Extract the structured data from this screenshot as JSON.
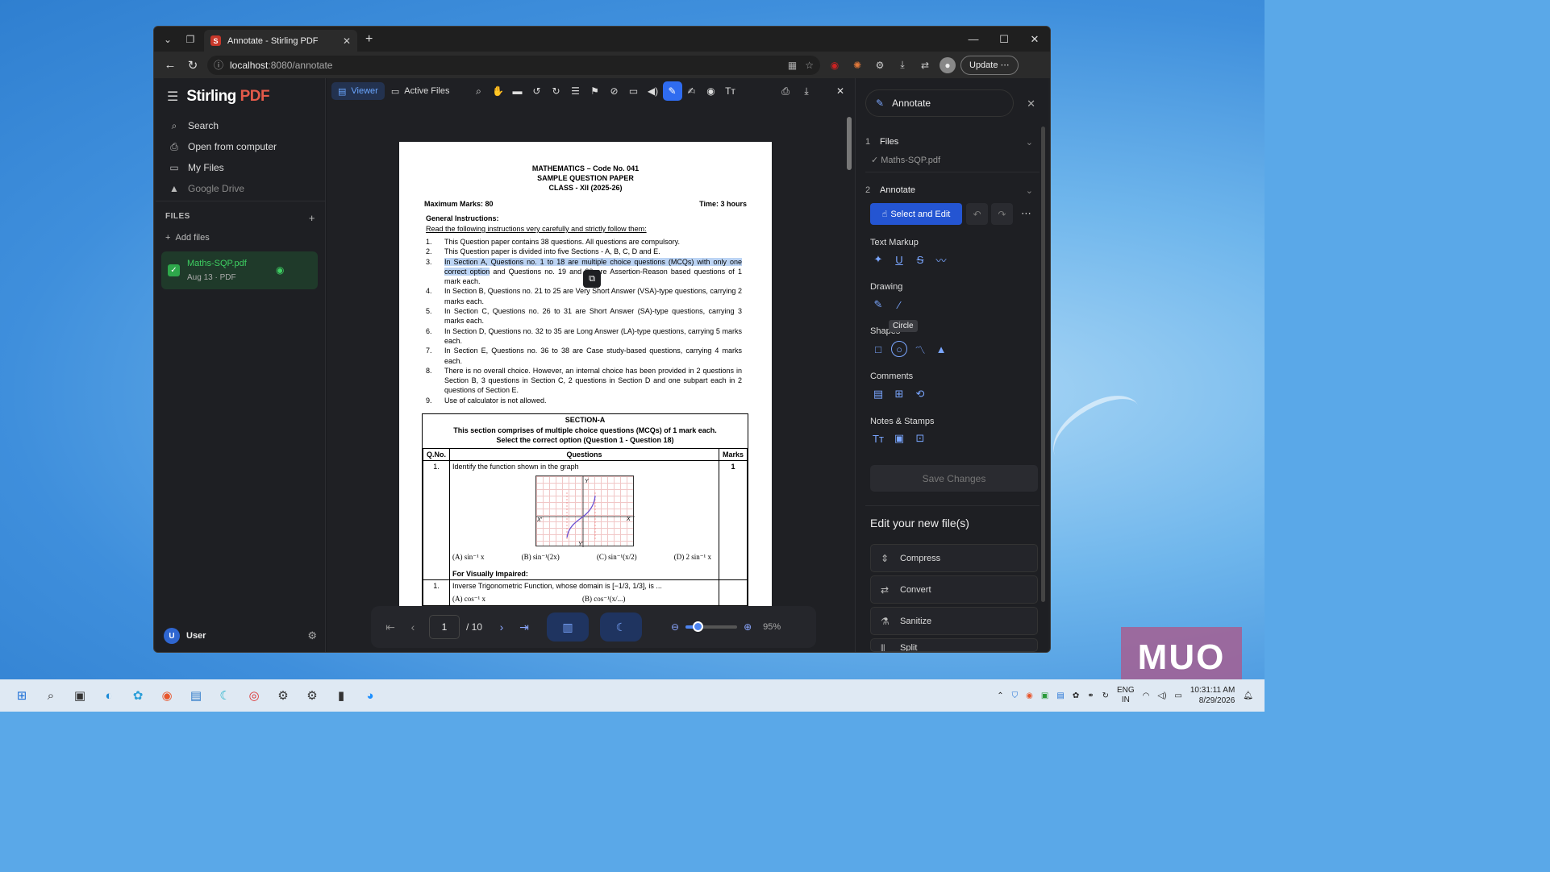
{
  "browser": {
    "tab_title": "Annotate - Stirling PDF",
    "url_host": "localhost",
    "url_path": ":8080/annotate",
    "update_label": "Update"
  },
  "app": {
    "brand_name": "Stirling",
    "brand_suffix": "PDF",
    "menu": [
      {
        "label": "Search",
        "icon": "search-icon"
      },
      {
        "label": "Open from computer",
        "icon": "file-upload-icon"
      },
      {
        "label": "My Files",
        "icon": "folder-icon"
      },
      {
        "label": "Google Drive",
        "icon": "google-drive-icon"
      }
    ],
    "files_header": "FILES",
    "add_files": "Add files",
    "file": {
      "name": "Maths-SQP.pdf",
      "meta": "Aug 13 · PDF"
    },
    "user_name": "User",
    "user_initial": "U"
  },
  "viewer": {
    "tabs": [
      "Viewer",
      "Active Files"
    ],
    "active_tool": "draw-icon",
    "page_number": "1",
    "page_total": "/ 10",
    "zoom": "95%",
    "zoom_fraction": 0.24
  },
  "document": {
    "heading": [
      "MATHEMATICS – Code No. 041",
      "SAMPLE QUESTION PAPER",
      "CLASS - XII (2025-26)"
    ],
    "max_marks": "Maximum Marks: 80",
    "time": "Time: 3 hours",
    "gi_title": "General Instructions:",
    "gi_read": "Read the following instructions very carefully and strictly follow them:",
    "instructions": [
      {
        "n": "1.",
        "t": "This Question paper contains 38 questions. All questions are compulsory."
      },
      {
        "n": "2.",
        "t": "This Question paper is divided into five Sections - A, B, C, D and E."
      },
      {
        "n": "3.",
        "hl": "In Section A, Questions no. 1 to 18 are multiple choice questions (MCQs) with only one correct option",
        "t": " and Questions no. 19 and 20 are Assertion-Reason based questions of 1 mark each."
      },
      {
        "n": "4.",
        "t": "In Section B, Questions no. 21 to 25 are Very Short Answer (VSA)-type questions, carrying 2 marks each."
      },
      {
        "n": "5.",
        "t": "In Section C, Questions no. 26 to 31 are Short Answer (SA)-type questions, carrying 3 marks each."
      },
      {
        "n": "6.",
        "t": "In Section D, Questions no. 32 to 35 are Long Answer (LA)-type questions, carrying 5 marks each."
      },
      {
        "n": "7.",
        "t": "In Section E, Questions no. 36 to 38 are Case study-based questions, carrying 4 marks each."
      },
      {
        "n": "8.",
        "t": "There is no overall choice. However, an internal choice has been provided in 2 questions in Section B, 3 questions in Section C, 2 questions in Section D and one subpart each in 2 questions of Section E."
      },
      {
        "n": "9.",
        "t": "Use of calculator is not allowed."
      }
    ],
    "section_title": "SECTION-A",
    "section_sub1": "This section comprises of multiple choice questions (MCQs) of 1 mark each.",
    "section_sub2": "Select the correct option (Question 1 - Question 18)",
    "col_qno": "Q.No.",
    "col_questions": "Questions",
    "col_marks": "Marks",
    "q1_no": "1.",
    "q1_text": "Identify the function shown in the graph",
    "q1_marks": "1",
    "q1_options": [
      "(A) sin⁻¹ x",
      "(B) sin⁻¹(2x)",
      "(C) sin⁻¹(x/2)",
      "(D) 2 sin⁻¹ x"
    ],
    "graph_labels": {
      "y": "Y",
      "x": "X",
      "xp": "X'",
      "yp": "Y'"
    },
    "vi_title": "For Visually Impaired:",
    "vi_no": "1.",
    "vi_text": "Inverse Trigonometric Function, whose domain is [−1/3, 1/3], is ...",
    "vi_opts_partial": [
      "(A) cos⁻¹ x",
      "(B) cos⁻¹(x/...)"
    ]
  },
  "panel": {
    "title": "Annotate",
    "step1_num": "1",
    "step1_label": "Files",
    "step1_file": "✓ Maths-SQP.pdf",
    "step2_num": "2",
    "step2_label": "Annotate",
    "select_edit": "Select and Edit",
    "groups": {
      "text_markup": "Text Markup",
      "drawing": "Drawing",
      "shapes": "Shapes",
      "comments": "Comments",
      "notes": "Notes & Stamps"
    },
    "tooltip": "Circle",
    "save": "Save Changes",
    "new_file_title": "Edit your new file(s)",
    "tools": [
      "Compress",
      "Convert",
      "Sanitize",
      "Split"
    ]
  },
  "taskbar": {
    "lang1": "ENG",
    "lang2": "IN",
    "time": "10:31:11 AM",
    "date": "8/29/2026"
  },
  "watermark": "MUO"
}
